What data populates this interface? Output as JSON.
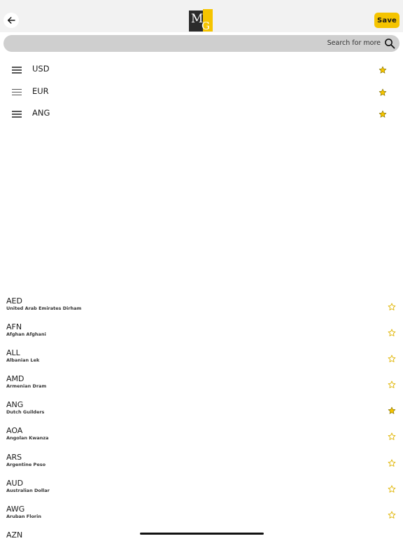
{
  "header": {
    "back_icon": "arrow-left-icon",
    "logo_icon": "mg-logo-icon",
    "save_label": "Save"
  },
  "colors": {
    "accent": "#f5c400",
    "search_bg": "#cfcfcf",
    "header_bg": "#f2f2f2"
  },
  "search": {
    "placeholder": "Search for more",
    "icon": "search-icon"
  },
  "favorites": [
    {
      "code": "USD",
      "favorite": true
    },
    {
      "code": "EUR",
      "favorite": true
    },
    {
      "code": "ANG",
      "favorite": true
    }
  ],
  "currencies": [
    {
      "code": "AED",
      "name": "United Arab Emirates Dirham",
      "favorite": false
    },
    {
      "code": "AFN",
      "name": "Afghan Afghani",
      "favorite": false
    },
    {
      "code": "ALL",
      "name": "Albanian Lek",
      "favorite": false
    },
    {
      "code": "AMD",
      "name": "Armenian Dram",
      "favorite": false
    },
    {
      "code": "ANG",
      "name": "Dutch Guilders",
      "favorite": true
    },
    {
      "code": "AOA",
      "name": "Angolan Kwanza",
      "favorite": false
    },
    {
      "code": "ARS",
      "name": "Argentine Peso",
      "favorite": false
    },
    {
      "code": "AUD",
      "name": "Australian Dollar",
      "favorite": false
    },
    {
      "code": "AWG",
      "name": "Aruban Florin",
      "favorite": false
    },
    {
      "code": "AZN",
      "name": "",
      "favorite": false
    }
  ]
}
